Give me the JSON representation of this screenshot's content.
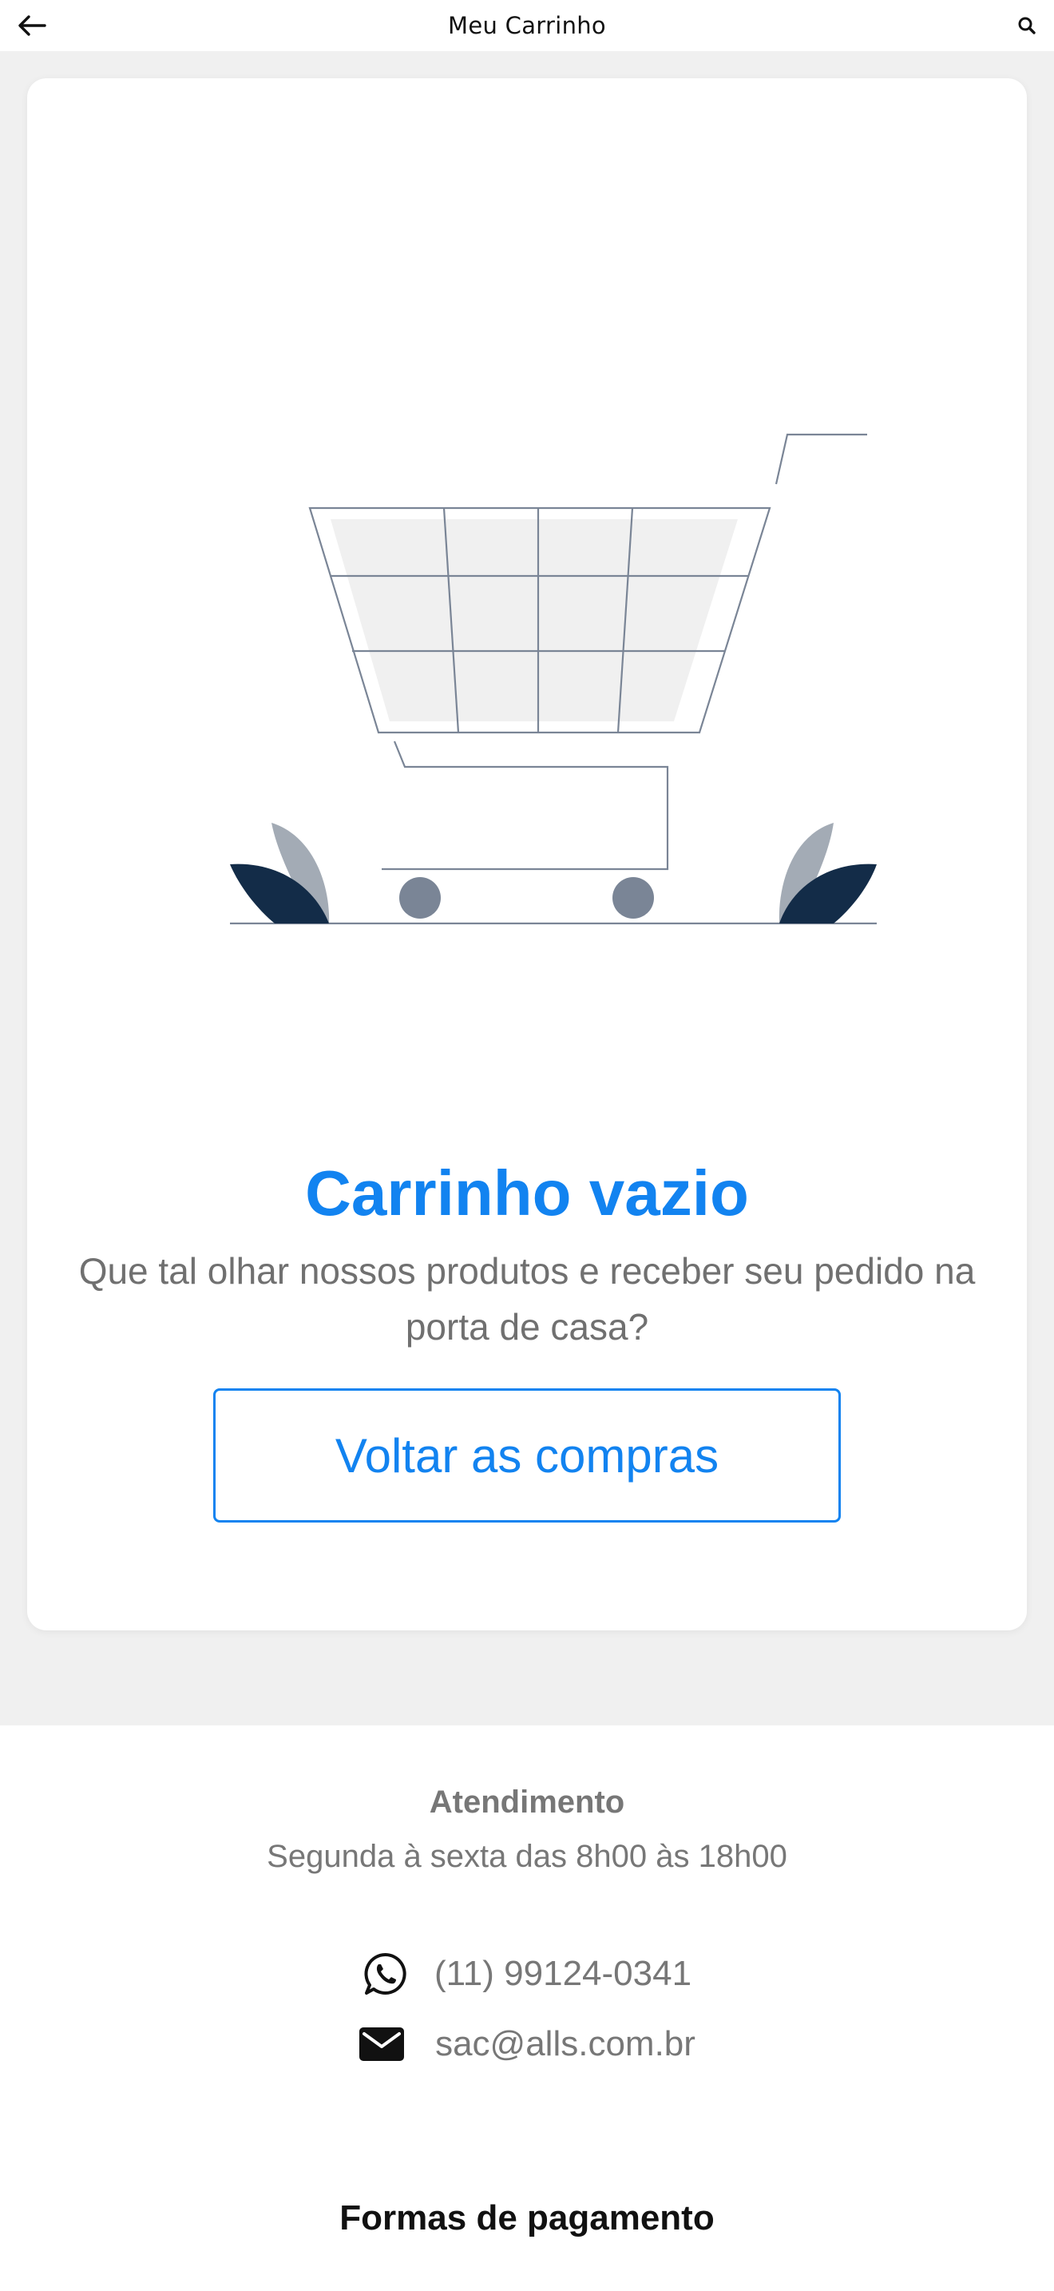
{
  "header": {
    "title": "Meu Carrinho",
    "back_icon": "arrow-left-icon",
    "search_icon": "search-icon"
  },
  "empty_cart": {
    "illustration": "shopping-cart-illustration",
    "title": "Carrinho vazio",
    "message": "Que tal olhar nossos produtos e receber seu pedido na porta de casa?",
    "button_label": "Voltar as compras"
  },
  "footer": {
    "support_title": "Atendimento",
    "support_hours": "Segunda à sexta das 8h00 às 18h00",
    "phone": "(11) 99124-0341",
    "email": "sac@alls.com.br",
    "payment_title": "Formas de pagamento"
  },
  "colors": {
    "accent": "#1283f0",
    "background": "#f0f0f0",
    "text_muted": "#777777",
    "illustration_dark": "#132c48",
    "illustration_line": "#7a8596"
  }
}
